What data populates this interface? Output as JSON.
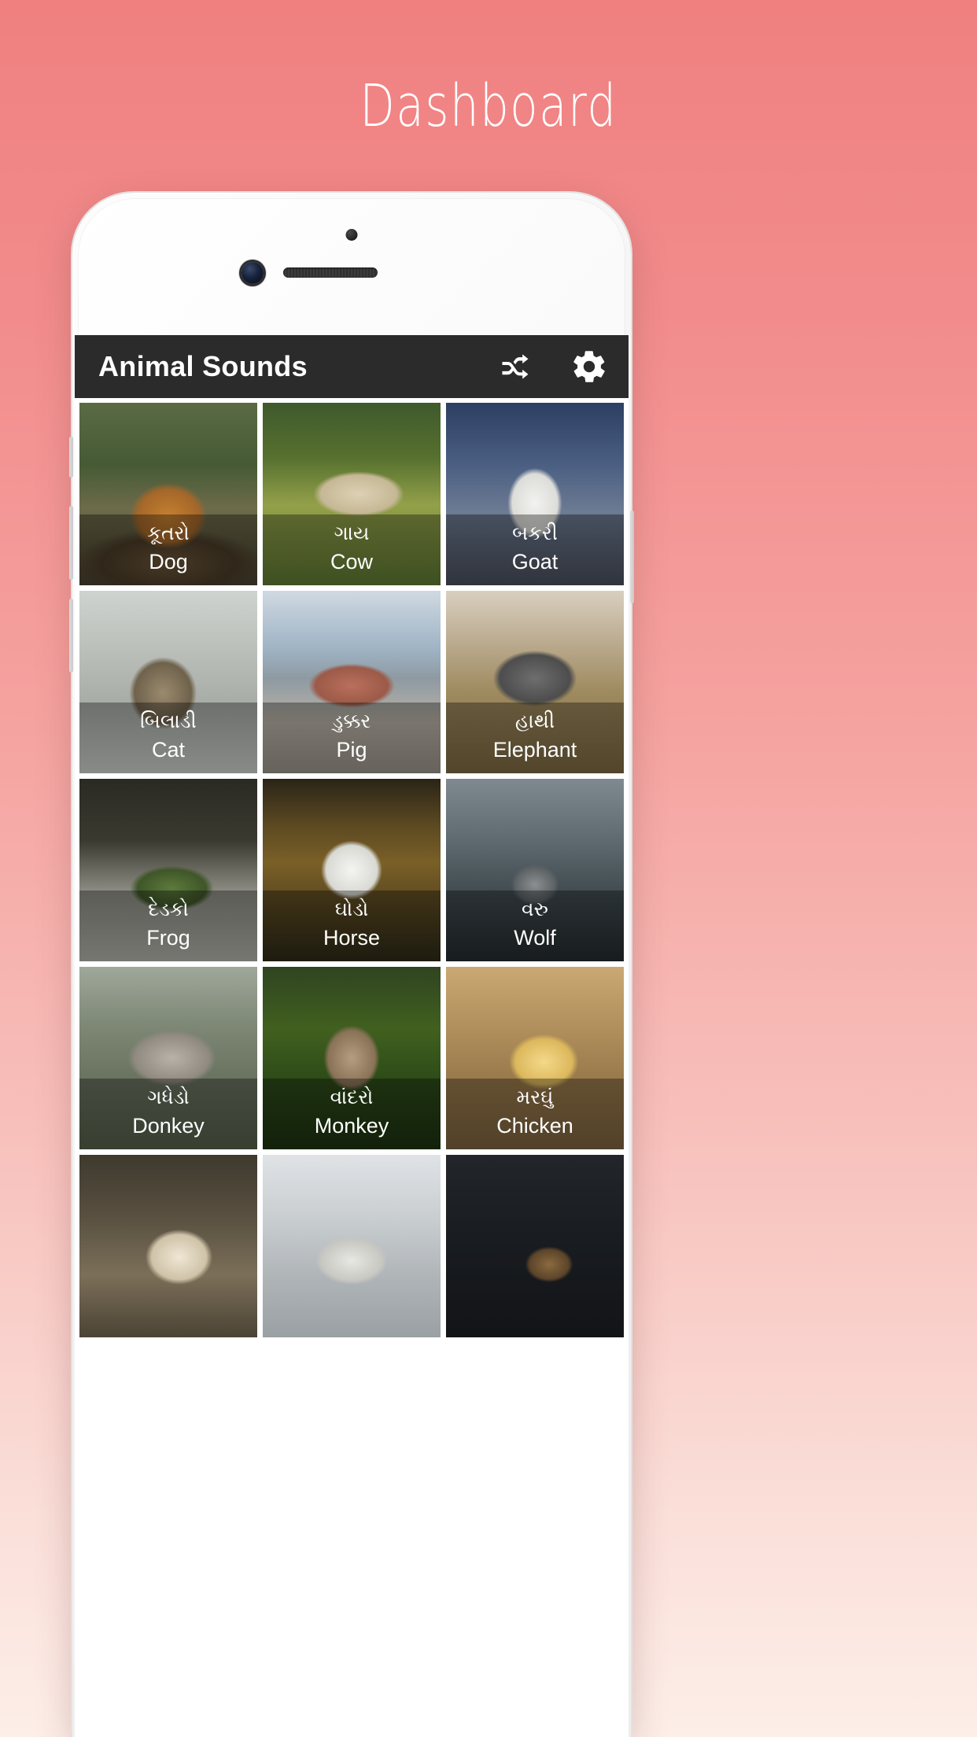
{
  "page": {
    "title": "Dashboard",
    "background_gradient_top": "#f08080",
    "background_gradient_bottom": "#fdeee8"
  },
  "app": {
    "toolbar": {
      "title": "Animal Sounds",
      "background_color": "#2b2b2b",
      "text_color": "#ffffff",
      "actions": [
        {
          "name": "shuffle-icon",
          "label": "Shuffle"
        },
        {
          "name": "settings-gear-icon",
          "label": "Settings"
        }
      ]
    },
    "grid": {
      "columns": 3,
      "items": [
        {
          "native": "કૂતરો",
          "english": "Dog",
          "scene": "sc-dog"
        },
        {
          "native": "ગાય",
          "english": "Cow",
          "scene": "sc-cow"
        },
        {
          "native": "બકરી",
          "english": "Goat",
          "scene": "sc-goat"
        },
        {
          "native": "બિલાડી",
          "english": "Cat",
          "scene": "sc-cat"
        },
        {
          "native": "ડુક્કર",
          "english": "Pig",
          "scene": "sc-pig"
        },
        {
          "native": "હાથી",
          "english": "Elephant",
          "scene": "sc-elephant"
        },
        {
          "native": "દેડકો",
          "english": "Frog",
          "scene": "sc-frog"
        },
        {
          "native": "ઘોડો",
          "english": "Horse",
          "scene": "sc-horse"
        },
        {
          "native": "વરુ",
          "english": "Wolf",
          "scene": "sc-wolf"
        },
        {
          "native": "ગધેડો",
          "english": "Donkey",
          "scene": "sc-donkey"
        },
        {
          "native": "વાંદરો",
          "english": "Monkey",
          "scene": "sc-monkey"
        },
        {
          "native": "મરઘું",
          "english": "Chicken",
          "scene": "sc-chicken"
        },
        {
          "native": "",
          "english": "",
          "scene": "sc-rooster"
        },
        {
          "native": "",
          "english": "",
          "scene": "sc-sheep"
        },
        {
          "native": "",
          "english": "",
          "scene": "sc-bird"
        }
      ]
    }
  }
}
